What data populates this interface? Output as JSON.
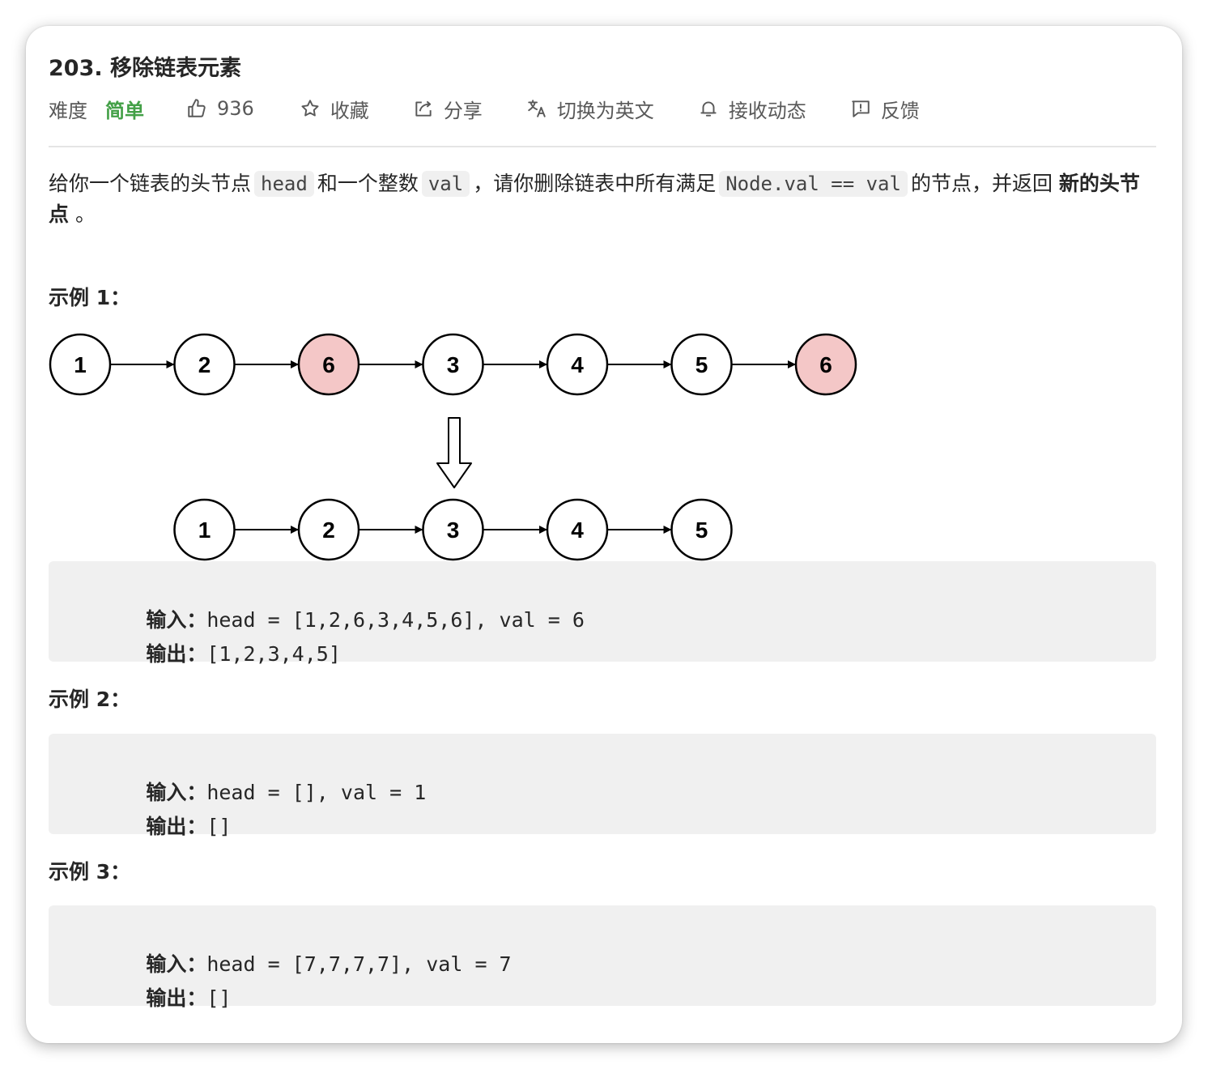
{
  "problem": {
    "title": "203. 移除链表元素",
    "difficulty_label": "难度",
    "difficulty_value": "简单",
    "likes": "936",
    "favorite_label": "收藏",
    "share_label": "分享",
    "switch_lang_label": "切换为英文",
    "subscribe_label": "接收动态",
    "feedback_label": "反馈",
    "colors": {
      "easy": "#43a047",
      "removed_node": "#f4c7c7"
    }
  },
  "description": {
    "t1": "给你一个链表的头节点",
    "c1": "head",
    "t2": "和一个整数",
    "c2": "val",
    "t3": "，请你删除链表中所有满足",
    "c3": "Node.val == val",
    "t4": "的节点，并返回",
    "b1": "新的头节点",
    "t5": "。"
  },
  "examples": [
    {
      "title": "示例 1：",
      "input_label": "输入：",
      "input_value": "head = [1,2,6,3,4,5,6], val = 6",
      "output_label": "输出：",
      "output_value": "[1,2,3,4,5]"
    },
    {
      "title": "示例 2：",
      "input_label": "输入：",
      "input_value": "head = [], val = 1",
      "output_label": "输出：",
      "output_value": "[]"
    },
    {
      "title": "示例 3：",
      "input_label": "输入：",
      "input_value": "head = [7,7,7,7], val = 7",
      "output_label": "输出：",
      "output_value": "[]"
    }
  ],
  "diagram": {
    "before": [
      "1",
      "2",
      "6",
      "3",
      "4",
      "5",
      "6"
    ],
    "removed": [
      false,
      false,
      true,
      false,
      false,
      false,
      true
    ],
    "after": [
      "1",
      "2",
      "3",
      "4",
      "5"
    ]
  }
}
